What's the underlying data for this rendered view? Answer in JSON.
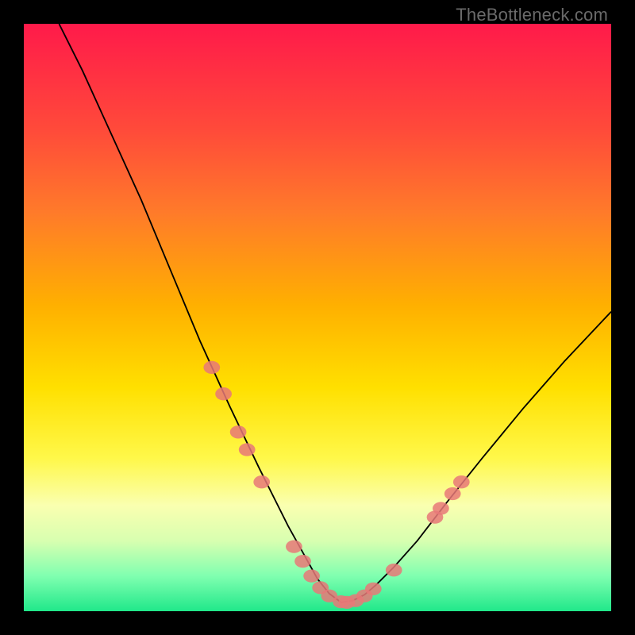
{
  "watermark": "TheBottleneck.com",
  "chart_data": {
    "type": "line",
    "title": "",
    "xlabel": "",
    "ylabel": "",
    "xlim": [
      0,
      100
    ],
    "ylim": [
      0,
      100
    ],
    "grid": false,
    "legend": false,
    "series": [
      {
        "name": "left-curve",
        "x": [
          6,
          10,
          15,
          20,
          25,
          30,
          35,
          40,
          45,
          50,
          52,
          54
        ],
        "values": [
          100,
          92,
          81,
          70,
          58,
          46,
          35,
          24.5,
          14.5,
          5.5,
          3.0,
          1.5
        ]
      },
      {
        "name": "right-curve",
        "x": [
          54,
          56,
          58,
          60,
          63,
          67,
          72,
          78,
          85,
          92,
          100
        ],
        "values": [
          1.5,
          1.8,
          2.8,
          4.5,
          7.5,
          12,
          18.5,
          26,
          34.5,
          42.5,
          51
        ]
      }
    ],
    "markers": {
      "name": "highlight-points",
      "color": "#e87878",
      "points": [
        {
          "x": 32,
          "y": 41.5
        },
        {
          "x": 34,
          "y": 37
        },
        {
          "x": 36.5,
          "y": 30.5
        },
        {
          "x": 38,
          "y": 27.5
        },
        {
          "x": 40.5,
          "y": 22
        },
        {
          "x": 46,
          "y": 11
        },
        {
          "x": 47.5,
          "y": 8.5
        },
        {
          "x": 49,
          "y": 6
        },
        {
          "x": 50.5,
          "y": 4
        },
        {
          "x": 52,
          "y": 2.6
        },
        {
          "x": 54,
          "y": 1.6
        },
        {
          "x": 55,
          "y": 1.5
        },
        {
          "x": 56.5,
          "y": 1.8
        },
        {
          "x": 58,
          "y": 2.6
        },
        {
          "x": 59.5,
          "y": 3.8
        },
        {
          "x": 63,
          "y": 7
        },
        {
          "x": 70,
          "y": 16
        },
        {
          "x": 71,
          "y": 17.5
        },
        {
          "x": 73,
          "y": 20
        },
        {
          "x": 74.5,
          "y": 22
        }
      ]
    },
    "background_gradient": {
      "from": "#ff1a4a",
      "to": "#20e88a"
    }
  }
}
